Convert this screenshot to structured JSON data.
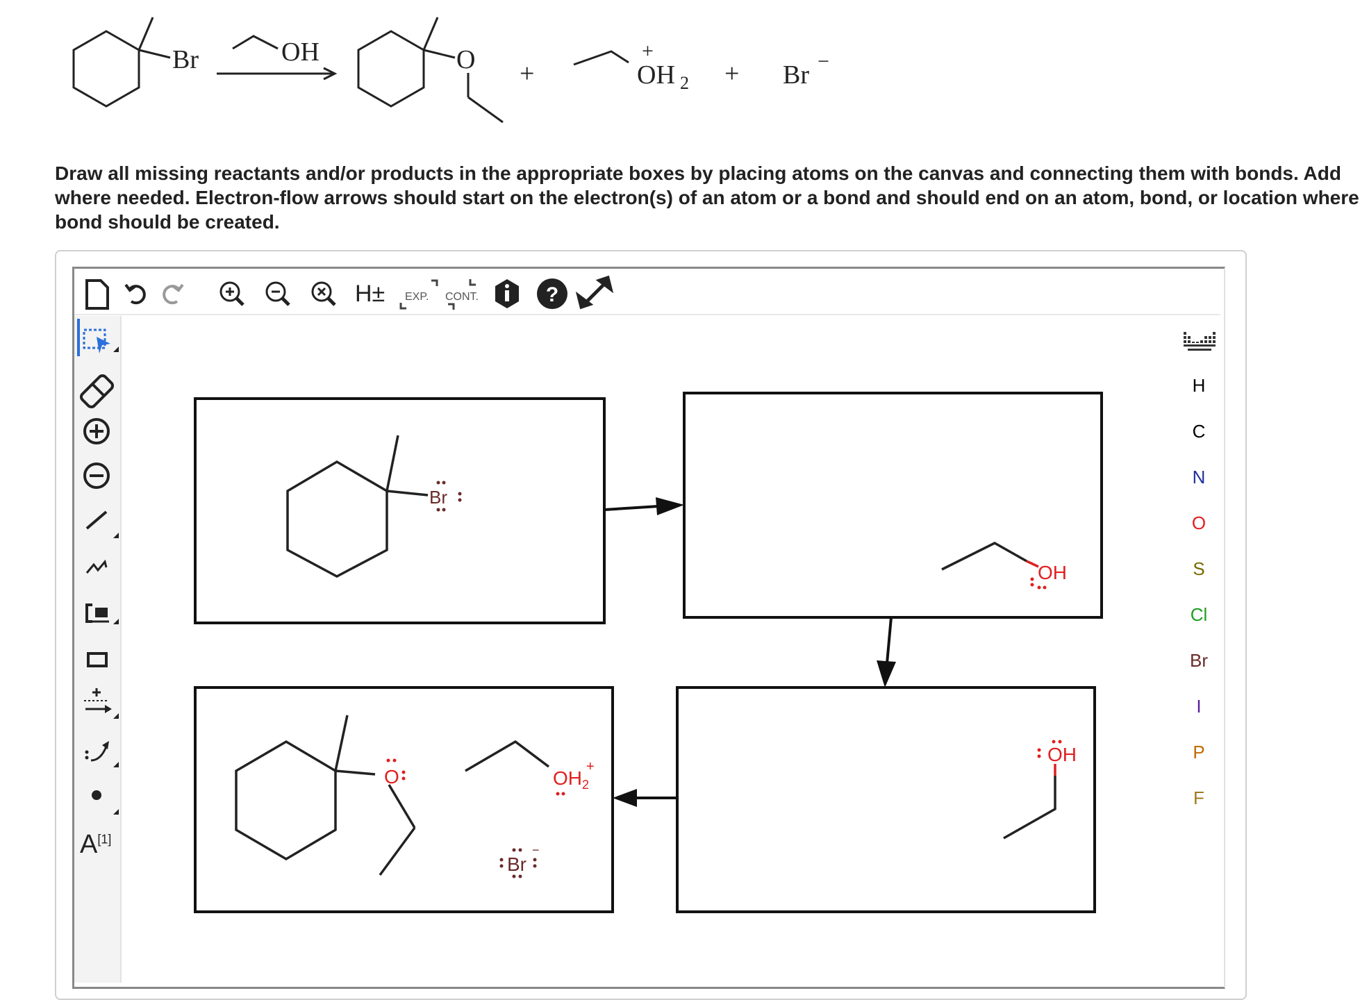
{
  "equation": {
    "reactant_label": "Br",
    "reagent_label": "OH",
    "product_o_label": "O",
    "plus_1": "+",
    "oh2_charge": "+",
    "oh2_label": "OH",
    "oh2_sub": "2",
    "plus_2": "+",
    "bromide_label": "Br",
    "bromide_charge": "−"
  },
  "instructions": {
    "line1": "Draw all missing reactants and/or products in the appropriate boxes by placing atoms on the canvas and connecting them with bonds. Add",
    "line2": "where needed. Electron-flow arrows should start on the electron(s) of an atom or a bond and should end on an atom, bond, or location where",
    "line3": "bond should be created."
  },
  "toolbar": {
    "h_toggle": "H±",
    "exp_label": "EXP.",
    "cont_label": "CONT."
  },
  "left_tools": {
    "text_tool_label": "A",
    "text_tool_sup": "[1]"
  },
  "elements": [
    {
      "symbol": "H",
      "color": "#333333"
    },
    {
      "symbol": "C",
      "color": "#000000"
    },
    {
      "symbol": "N",
      "color": "#1f2f9e"
    },
    {
      "symbol": "O",
      "color": "#e02020"
    },
    {
      "symbol": "S",
      "color": "#7a6a00"
    },
    {
      "symbol": "Cl",
      "color": "#1f9e1f"
    },
    {
      "symbol": "Br",
      "color": "#6b2a2a"
    },
    {
      "symbol": "I",
      "color": "#5a1f9e"
    },
    {
      "symbol": "P",
      "color": "#c06a00"
    },
    {
      "symbol": "F",
      "color": "#9e7a1f"
    }
  ],
  "canvas": {
    "box1": {
      "br_label": "Br"
    },
    "box2": {
      "oh_label": "OH"
    },
    "box3": {
      "oh_label": "OH"
    },
    "box4": {
      "o_label": "O",
      "oh2_label": "OH",
      "oh2_sub": "2",
      "oh2_charge": "+",
      "br_label": "Br",
      "br_charge": "−"
    }
  },
  "colors": {
    "oxygen": "#e02020",
    "bromine": "#6b2a2a",
    "selected_tool": "#2a6fdb"
  }
}
